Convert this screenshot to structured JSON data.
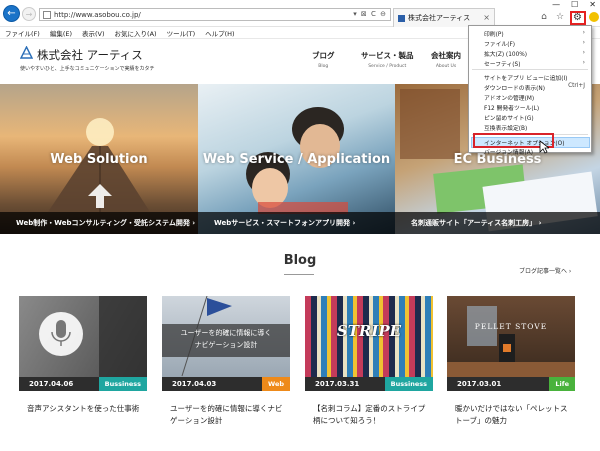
{
  "browser": {
    "url": "http://www.asobou.co.jp/",
    "tab_title": "株式会社アーティス",
    "addr_icons": "▾ ⊠ C ⊖",
    "window_controls": [
      "—",
      "☐",
      "✕"
    ]
  },
  "menubar": [
    "ファイル(F)",
    "編集(E)",
    "表示(V)",
    "お気に入り(A)",
    "ツール(T)",
    "ヘルプ(H)"
  ],
  "site": {
    "logo_name": "株式会社 アーティス",
    "tagline": "使いやすいひと、上手なコミュニケーションで実績をカタチ",
    "nav": [
      {
        "jp": "ブログ",
        "en": "Blog"
      },
      {
        "jp": "サービス・製品",
        "en": "Service / Product"
      },
      {
        "jp": "会社案内",
        "en": "About Us"
      }
    ]
  },
  "hero": [
    {
      "title": "Web Solution",
      "caption": "Web制作・Webコンサルティング・受託システム開発  ›"
    },
    {
      "title": "Web Service / Application",
      "caption": "Webサービス・スマートフォンアプリ開発  ›"
    },
    {
      "title": "EC Business",
      "caption": "名刺通販サイト「アーティス名刺工房」  ›"
    }
  ],
  "dropdown": {
    "items": [
      {
        "label": "印刷(P)",
        "arrow": "›"
      },
      {
        "label": "ファイル(F)",
        "arrow": "›"
      },
      {
        "label": "拡大(Z) (100%)",
        "arrow": "›"
      },
      {
        "label": "セーフティ(S)",
        "arrow": "›"
      },
      {
        "label": "サイトをアプリ ビューに追加(I)",
        "arrow": ""
      },
      {
        "label": "ダウンロードの表示(N)",
        "shortcut": "Ctrl+J"
      },
      {
        "label": "アドオンの管理(M)",
        "arrow": ""
      },
      {
        "label": "F12 開発者ツール(L)",
        "arrow": ""
      },
      {
        "label": "ピン留めサイト(G)",
        "arrow": ""
      },
      {
        "label": "互換表示設定(B)",
        "arrow": ""
      },
      {
        "label": "インターネット オプション(O)",
        "arrow": ""
      },
      {
        "label": "バージョン情報(A)",
        "arrow": ""
      }
    ]
  },
  "blog": {
    "title": "Blog",
    "more": "ブログ記事一覧へ  ›",
    "cards": [
      {
        "date": "2017.04.06",
        "category": "Bussiness",
        "cat_color": "#1fa6a0",
        "title": "音声アシスタントを使った仕事術"
      },
      {
        "date": "2017.04.03",
        "category": "Web",
        "cat_color": "#ee8a1a",
        "title": "ユーザーを的確に情報に導くナビゲーション設計",
        "overlay": "ユーザーを的確に情報に導く\nナビゲーション設計"
      },
      {
        "date": "2017.03.31",
        "category": "Bussiness",
        "cat_color": "#1fa6a0",
        "title": "【名刺コラム】定番のストライプ柄について知ろう！",
        "overlay": "STRIPE"
      },
      {
        "date": "2017.03.01",
        "category": "Life",
        "cat_color": "#49b23c",
        "title": "暖かいだけではない「ペレットストーブ」の魅力",
        "overlay": "PELLET STOVE"
      }
    ]
  }
}
